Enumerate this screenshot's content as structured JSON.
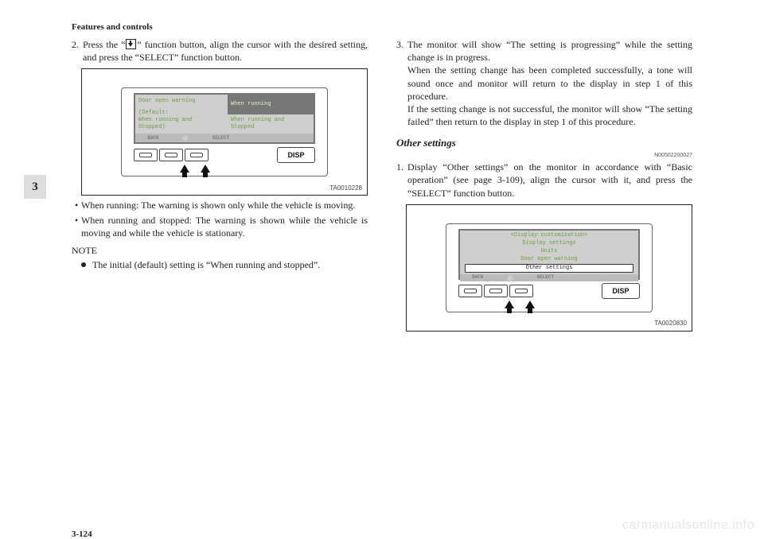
{
  "header": "Features and controls",
  "side_tab": "3",
  "page_number": "3-124",
  "watermark": "carmanualsonline.info",
  "left": {
    "step2_num": "2.",
    "step2_text_a": "Press the “",
    "step2_text_b": "” function button, align the cursor with the desired setting, and press the “SELECT” function button.",
    "fig1": {
      "label": "TA0010228",
      "left_title": "Door open warning",
      "left_default1": "(Default:",
      "left_default2": "When running and",
      "left_default3": "Stopped)",
      "opt_sel": "When running",
      "opt_un1": "When running and",
      "opt_un2": "Stopped",
      "footer_back": "BACK",
      "footer_select": "SELECT",
      "disp": "DISP"
    },
    "bullet1": "When running: The warning is shown only while the vehicle is moving.",
    "bullet2": "When running and stopped: The warning is shown while the vehicle is moving and while the vehicle is stationary.",
    "note_head": "NOTE",
    "note_text": "The initial (default) setting is “When running and stopped”."
  },
  "right": {
    "step3_num": "3.",
    "step3_p1": "The monitor will show “The setting is progressing” while the setting change is in progress.",
    "step3_p2": "When the setting change has been completed successfully, a tone will sound once and monitor will return to the display in step 1 of this procedure.",
    "step3_p3": "If the setting change is not successful, the monitor will show “The setting failed” then return to the display in step 1 of this procedure.",
    "subhead": "Other settings",
    "refnum": "N00502200027",
    "step1_num": "1.",
    "step1_text": "Display “Other settings” on the monitor in accordance with “Basic operation” (see page 3-109), align the cursor with it, and press the “SELECT” function button.",
    "fig2": {
      "label": "TA0020830",
      "title": "<Display customization>",
      "item1": "Display settings",
      "item2": "Units",
      "item3": "Door open warning",
      "item_sel": "Other settings",
      "footer_back": "BACK",
      "footer_select": "SELECT",
      "disp": "DISP"
    }
  }
}
